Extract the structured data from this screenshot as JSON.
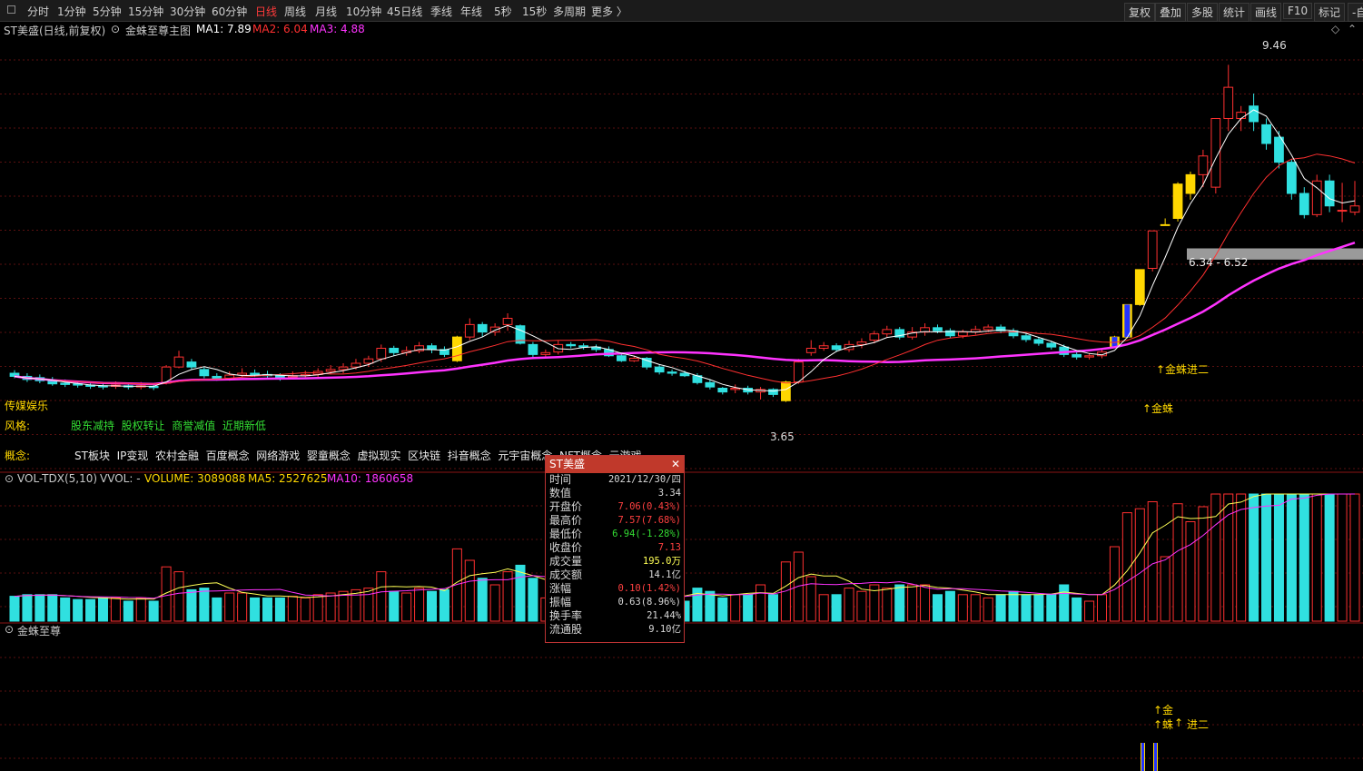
{
  "toolbar": {
    "periods": [
      "分时",
      "1分钟",
      "5分钟",
      "15分钟",
      "30分钟",
      "60分钟",
      "日线",
      "周线",
      "月线",
      "10分钟",
      "45日线",
      "季线",
      "年线",
      "5秒",
      "15秒",
      "多周期",
      "更多 〉"
    ],
    "active_period": "日线",
    "right_buttons": [
      "复权",
      "叠加",
      "多股",
      "统计",
      "画线",
      "F10",
      "标记",
      "-自"
    ]
  },
  "main_header": {
    "stock": "ST美盛(日线,前复权)",
    "indicator": "金蛛至尊主图",
    "ma1": "MA1: 7.89",
    "ma2": "MA2: 6.04",
    "ma3": "MA3: 4.88",
    "colors": {
      "ma1": "#ffffff",
      "ma2": "#ff3030",
      "ma3": "#ff33ff"
    }
  },
  "annotations": {
    "high": "9.46",
    "low": "3.65",
    "zone": "6.34 - 6.52",
    "jinzhu_jin_er": "↑金蛛进二",
    "jinzhu": "↑金蛛",
    "left_tag": "传媒娱乐"
  },
  "info": {
    "style_label": "风格:",
    "style_values": "股东减持  股权转让  商誉减值  近期新低",
    "concept_label": "概念:",
    "concept_values": "ST板块  IP变现  农村金融  百度概念  网络游戏  婴童概念  虚拟现实  区块链  抖音概念  元宇宙概念  NFT概念  云游戏"
  },
  "volume_header": {
    "name": "VOL-TDX(5,10)",
    "vvol": "VVOL: -",
    "volume": "VOLUME: 3089088",
    "ma5": "MA5: 2527625",
    "ma10": "MA10: 1860658"
  },
  "bottom_header": {
    "name": "金蛛至尊"
  },
  "bottom_signals": {
    "jin": "↑金",
    "zhu": "↑蛛",
    "arrow": "↑",
    "jiner": "进二"
  },
  "tooltip": {
    "title": "ST美盛",
    "close": "✕",
    "rows": [
      {
        "k": "时间",
        "v": "2021/12/30/四",
        "color": "#d8d8d8"
      },
      {
        "k": "数值",
        "v": "3.34",
        "color": "#d8d8d8"
      },
      {
        "k": "开盘价",
        "v": "7.06(0.43%)",
        "color": "#ff4040"
      },
      {
        "k": "最高价",
        "v": "7.57(7.68%)",
        "color": "#ff4040"
      },
      {
        "k": "最低价",
        "v": "6.94(-1.28%)",
        "color": "#33dd33"
      },
      {
        "k": "收盘价",
        "v": "7.13",
        "color": "#ff4040"
      },
      {
        "k": "成交量",
        "v": "195.0万",
        "color": "#ffff55"
      },
      {
        "k": "成交额",
        "v": "14.1亿",
        "color": "#d8d8d8"
      },
      {
        "k": "涨幅",
        "v": "0.10(1.42%)",
        "color": "#ff4040"
      },
      {
        "k": "振幅",
        "v": "0.63(8.96%)",
        "color": "#d8d8d8"
      },
      {
        "k": "换手率",
        "v": "21.44%",
        "color": "#d8d8d8"
      },
      {
        "k": "流通股",
        "v": "9.10亿",
        "color": "#d8d8d8"
      }
    ]
  },
  "chart_data": {
    "type": "candlestick",
    "price_range": [
      3.4,
      9.8
    ],
    "candles": [
      [
        4.52,
        4.47,
        4.57,
        4.44
      ],
      [
        4.47,
        4.42,
        4.52,
        4.38
      ],
      [
        4.45,
        4.4,
        4.5,
        4.36
      ],
      [
        4.4,
        4.35,
        4.46,
        4.32
      ],
      [
        4.36,
        4.34,
        4.42,
        4.3
      ],
      [
        4.35,
        4.33,
        4.4,
        4.29
      ],
      [
        4.33,
        4.31,
        4.38,
        4.27
      ],
      [
        4.32,
        4.3,
        4.38,
        4.26
      ],
      [
        4.31,
        4.33,
        4.39,
        4.27
      ],
      [
        4.32,
        4.3,
        4.36,
        4.26
      ],
      [
        4.3,
        4.32,
        4.38,
        4.26
      ],
      [
        4.31,
        4.29,
        4.35,
        4.25
      ],
      [
        4.36,
        4.62,
        4.65,
        4.34
      ],
      [
        4.62,
        4.78,
        4.88,
        4.6
      ],
      [
        4.7,
        4.62,
        4.75,
        4.58
      ],
      [
        4.58,
        4.48,
        4.62,
        4.44
      ],
      [
        4.47,
        4.44,
        4.52,
        4.4
      ],
      [
        4.44,
        4.49,
        4.55,
        4.4
      ],
      [
        4.49,
        4.52,
        4.6,
        4.45
      ],
      [
        4.52,
        4.5,
        4.58,
        4.46
      ],
      [
        4.5,
        4.48,
        4.56,
        4.44
      ],
      [
        4.48,
        4.45,
        4.52,
        4.4
      ],
      [
        4.46,
        4.48,
        4.55,
        4.42
      ],
      [
        4.48,
        4.5,
        4.56,
        4.44
      ],
      [
        4.5,
        4.55,
        4.6,
        4.46
      ],
      [
        4.55,
        4.58,
        4.65,
        4.5
      ],
      [
        4.58,
        4.62,
        4.68,
        4.52
      ],
      [
        4.62,
        4.68,
        4.75,
        4.58
      ],
      [
        4.68,
        4.75,
        4.8,
        4.62
      ],
      [
        4.75,
        4.92,
        4.98,
        4.7
      ],
      [
        4.92,
        4.85,
        4.96,
        4.8
      ],
      [
        4.85,
        4.88,
        4.95,
        4.8
      ],
      [
        4.88,
        4.96,
        5.02,
        4.84
      ],
      [
        4.96,
        4.9,
        5.0,
        4.84
      ],
      [
        4.9,
        4.82,
        4.95,
        4.78
      ],
      [
        4.72,
        5.1,
        5.12,
        4.7
      ],
      [
        5.1,
        5.3,
        5.4,
        5.05
      ],
      [
        5.3,
        5.18,
        5.34,
        5.1
      ],
      [
        5.18,
        5.26,
        5.32,
        5.12
      ],
      [
        5.3,
        5.4,
        5.48,
        5.2
      ],
      [
        5.28,
        5.0,
        5.3,
        4.98
      ],
      [
        4.98,
        4.82,
        5.02,
        4.78
      ],
      [
        4.82,
        4.85,
        4.9,
        4.78
      ],
      [
        4.86,
        4.98,
        5.05,
        4.82
      ],
      [
        4.98,
        4.96,
        5.02,
        4.92
      ],
      [
        4.96,
        4.94,
        5.0,
        4.9
      ],
      [
        4.94,
        4.9,
        4.98,
        4.86
      ],
      [
        4.9,
        4.8,
        4.95,
        4.78
      ],
      [
        4.8,
        4.72,
        4.84,
        4.7
      ],
      [
        4.72,
        4.76,
        4.8,
        4.7
      ],
      [
        4.76,
        4.62,
        4.78,
        4.58
      ],
      [
        4.62,
        4.54,
        4.66,
        4.5
      ],
      [
        4.54,
        4.52,
        4.58,
        4.48
      ],
      [
        4.52,
        4.48,
        4.56,
        4.46
      ],
      [
        4.48,
        4.37,
        4.52,
        4.34
      ],
      [
        4.37,
        4.3,
        4.42,
        4.26
      ],
      [
        4.28,
        4.22,
        4.3,
        4.18
      ],
      [
        4.26,
        4.28,
        4.34,
        4.2
      ],
      [
        4.28,
        4.22,
        4.32,
        4.18
      ],
      [
        4.22,
        4.26,
        4.3,
        4.1
      ],
      [
        4.26,
        4.18,
        4.28,
        4.14
      ],
      [
        4.08,
        4.38,
        4.4,
        4.06
      ],
      [
        4.38,
        4.7,
        4.75,
        4.35
      ],
      [
        4.85,
        4.92,
        5.05,
        4.8
      ],
      [
        4.92,
        4.96,
        5.02,
        4.88
      ],
      [
        4.96,
        4.9,
        5.0,
        4.86
      ],
      [
        4.9,
        4.98,
        5.04,
        4.86
      ],
      [
        4.98,
        5.02,
        5.08,
        4.92
      ],
      [
        5.05,
        5.15,
        5.2,
        5.0
      ],
      [
        5.15,
        5.22,
        5.28,
        5.1
      ],
      [
        5.22,
        5.1,
        5.26,
        5.06
      ],
      [
        5.1,
        5.18,
        5.26,
        5.06
      ],
      [
        5.18,
        5.25,
        5.32,
        5.12
      ],
      [
        5.25,
        5.2,
        5.3,
        5.16
      ],
      [
        5.2,
        5.12,
        5.24,
        5.08
      ],
      [
        5.12,
        5.18,
        5.22,
        5.08
      ],
      [
        5.18,
        5.22,
        5.28,
        5.14
      ],
      [
        5.22,
        5.26,
        5.3,
        5.18
      ],
      [
        5.26,
        5.2,
        5.3,
        5.16
      ],
      [
        5.2,
        5.12,
        5.24,
        5.08
      ],
      [
        5.12,
        5.06,
        5.16,
        5.02
      ],
      [
        5.06,
        5.0,
        5.1,
        4.96
      ],
      [
        5.0,
        4.94,
        5.04,
        4.9
      ],
      [
        4.94,
        4.82,
        4.98,
        4.78
      ],
      [
        4.82,
        4.78,
        4.86,
        4.74
      ],
      [
        4.78,
        4.8,
        4.84,
        4.74
      ],
      [
        4.8,
        4.86,
        4.9,
        4.76
      ],
      [
        4.95,
        5.1,
        5.12,
        4.92
      ],
      [
        5.1,
        5.62,
        5.62,
        5.08
      ],
      [
        5.62,
        6.18,
        6.18,
        5.6
      ],
      [
        6.2,
        6.8,
        6.8,
        6.15
      ],
      [
        6.9,
        6.9,
        7.0,
        6.9
      ],
      [
        7.0,
        7.55,
        7.58,
        6.95
      ],
      [
        7.4,
        7.7,
        7.75,
        7.3
      ],
      [
        7.7,
        8.0,
        8.1,
        7.5
      ],
      [
        7.5,
        8.6,
        8.6,
        7.4
      ],
      [
        8.6,
        9.1,
        9.46,
        8.4
      ],
      [
        8.6,
        8.7,
        8.8,
        8.4
      ],
      [
        8.8,
        8.55,
        9.0,
        8.4
      ],
      [
        8.5,
        8.2,
        8.6,
        8.1
      ],
      [
        8.3,
        7.9,
        8.4,
        7.8
      ],
      [
        7.9,
        7.4,
        7.95,
        7.3
      ],
      [
        7.4,
        7.06,
        7.5,
        7.0
      ],
      [
        7.06,
        7.6,
        7.7,
        7.02
      ],
      [
        7.6,
        7.2,
        7.7,
        7.1
      ],
      [
        7.13,
        7.13,
        7.57,
        6.94
      ],
      [
        7.1,
        7.2,
        7.6,
        7.05
      ]
    ],
    "up_candle_color": "#ff3030",
    "down_candle_color": "#30e0e0",
    "signal_candle_color": "#ffd700",
    "ma1_color": "#ffffff",
    "ma2_color": "#ff3030",
    "ma3_color": "#ff33ff",
    "zone_color": "#9a9a9a",
    "volume_bar_color_up": "#ff3030",
    "volume_bar_color_down": "#30e0e0"
  }
}
